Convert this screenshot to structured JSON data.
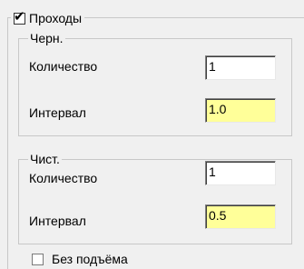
{
  "passes": {
    "checkbox_checked": true,
    "label": "Проходы"
  },
  "rough": {
    "title": "Черн.",
    "quantity_label": "Количество",
    "quantity_value": "1",
    "interval_label": "Интервал",
    "interval_value": "1.0"
  },
  "finish": {
    "title": "Чист.",
    "quantity_label": "Количество",
    "quantity_value": "1",
    "interval_label": "Интервал",
    "interval_value": "0.5"
  },
  "no_lift": {
    "checkbox_checked": false,
    "label": "Без подъёма"
  },
  "colors": {
    "highlight_field": "#ffff99",
    "field_background": "#ffffff",
    "window_background": "#f0f0f0"
  },
  "icons": {
    "check_mark": "✔"
  }
}
